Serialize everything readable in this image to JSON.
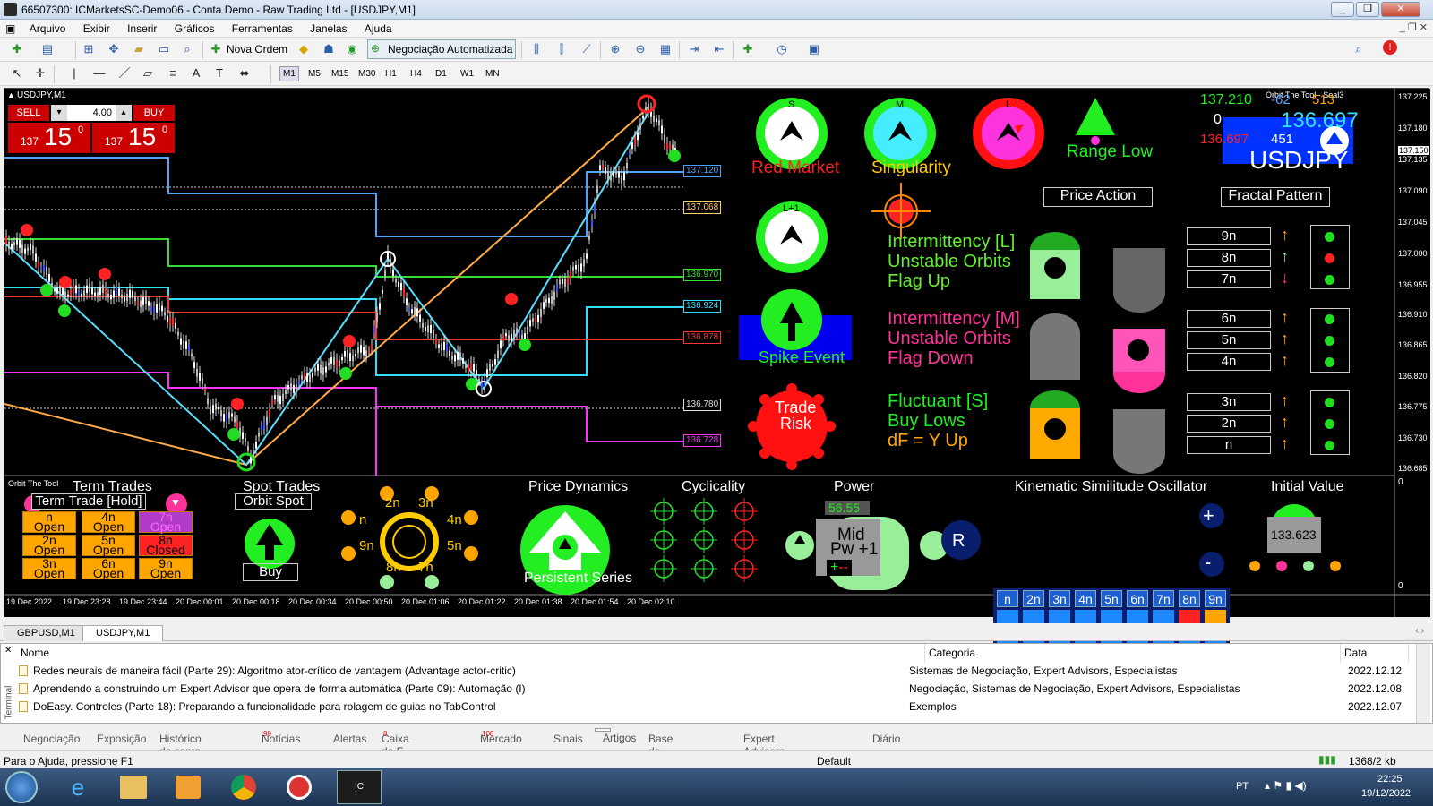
{
  "window": {
    "title": "66507300: ICMarketsSC-Demo06 - Conta Demo - Raw Trading Ltd - [USDJPY,M1]"
  },
  "menu": [
    "Arquivo",
    "Exibir",
    "Inserir",
    "Gráficos",
    "Ferramentas",
    "Janelas",
    "Ajuda"
  ],
  "toolbar": {
    "new_order": "Nova Ordem",
    "auto_trading": "Negociação Automatizada"
  },
  "timeframes": [
    "M1",
    "M5",
    "M15",
    "M30",
    "H1",
    "H4",
    "D1",
    "W1",
    "MN"
  ],
  "chart": {
    "symbol_label": "USDJPY,M1",
    "trade_panel": {
      "sell": "SELL",
      "buy": "BUY",
      "lot": "4.00",
      "sell_prefix": "137",
      "sell_price": "15",
      "sell_sup": "0",
      "buy_prefix": "137",
      "buy_price": "15",
      "buy_sup": "0"
    },
    "price_axis": [
      "137.225",
      "137.180",
      "137.150",
      "137.135",
      "137.090",
      "137.045",
      "137.000",
      "136.955",
      "136.910",
      "136.865",
      "136.820",
      "136.775",
      "136.730",
      "136.685"
    ],
    "level_labels": [
      {
        "text": "137.120",
        "color": "#4da3ff"
      },
      {
        "text": "137.068",
        "color": "#ffcc66"
      },
      {
        "text": "136.970",
        "color": "#33dd33"
      },
      {
        "text": "136.924",
        "color": "#33ddff"
      },
      {
        "text": "136.878",
        "color": "#ff3333"
      },
      {
        "text": "136.780",
        "color": "#dddddd"
      },
      {
        "text": "136.728",
        "color": "#ff33ff"
      }
    ],
    "time_axis": [
      "19 Dec 2022",
      "19 Dec 23:28",
      "19 Dec 23:44",
      "20 Dec 00:01",
      "20 Dec 00:18",
      "20 Dec 00:34",
      "20 Dec 00:50",
      "20 Dec 01:06",
      "20 Dec 01:22",
      "20 Dec 01:38",
      "20 Dec 01:54",
      "20 Dec 02:10"
    ],
    "corner_title": "Orbit The Tool - Seal3",
    "info": {
      "price_green": "137.210",
      "zero": "0",
      "num_blue1": "-62",
      "num_orange": "513",
      "price_red": "136.697",
      "big_price": "136.697",
      "count": "451",
      "symbol": "USDJPY"
    },
    "gauges": {
      "red_market": "Red Market",
      "singularity": "Singularity",
      "range_low": "Range Low",
      "spike_event": "Spike Event",
      "trade": "Trade",
      "risk": "Risk",
      "s": "S",
      "m": "M",
      "l": "L",
      "l1": "L+1"
    },
    "headers": {
      "price_action": "Price Action",
      "fractal_pattern": "Fractal Pattern"
    },
    "intermittency_l": [
      "Intermittency [L]",
      "Unstable Orbits",
      "Flag Up"
    ],
    "intermittency_m": [
      "Intermittency [M]",
      "Unstable Orbits",
      "Flag Down"
    ],
    "fluctuant_s": [
      "Fluctuant [S]",
      "Buy Lows",
      "dF = Y Up"
    ],
    "fractal_rows": [
      "9n",
      "8n",
      "7n",
      "6n",
      "5n",
      "4n",
      "3n",
      "2n",
      "n"
    ],
    "panel_colors": {
      "green": "#33cc33",
      "pink": "#ff3399",
      "orange": "#ffa500"
    }
  },
  "subwindow": {
    "label": "Orbit The Tool",
    "term_trades": "Term Trades",
    "term_trade_hold": "Term Trade [Hold]",
    "tt_cells": [
      {
        "n": "n",
        "s": "Open"
      },
      {
        "n": "4n",
        "s": "Open"
      },
      {
        "n": "7n",
        "s": "Open"
      },
      {
        "n": "2n",
        "s": "Open"
      },
      {
        "n": "5n",
        "s": "Open"
      },
      {
        "n": "8n",
        "s": "Closed"
      },
      {
        "n": "3n",
        "s": "Open"
      },
      {
        "n": "6n",
        "s": "Open"
      },
      {
        "n": "9n",
        "s": "Open"
      }
    ],
    "spot_trades": "Spot Trades",
    "orbit_spot": "Orbit Spot",
    "buy": "Buy",
    "orbit_labels": [
      "2n",
      "3n",
      "n",
      "4n",
      "9n",
      "5n",
      "8n",
      "7n"
    ],
    "price_dynamics": "Price Dynamics",
    "persistent_series": "Persistent Series",
    "cyclicality": "Cyclicality",
    "power": "Power",
    "power_value": "56.55",
    "mid": "Mid",
    "pw": "Pw +1",
    "kso_title": "Kinematic Similitude Oscillator",
    "kso_cols": [
      "n",
      "2n",
      "3n",
      "4n",
      "5n",
      "6n",
      "7n",
      "8n",
      "9n"
    ],
    "r": "R",
    "plus": "+",
    "minus": "-",
    "initial_value": "Initial Value",
    "initial_number": "133.623",
    "sub_axis": [
      "0",
      "0"
    ]
  },
  "chart_tabs": [
    "GBPUSD,M1",
    "USDJPY,M1"
  ],
  "terminal": {
    "headers": [
      "Nome",
      "Categoria",
      "Data"
    ],
    "rows": [
      {
        "name": "Redes neurais de maneira fácil (Parte 29): Algoritmo ator-crítico de vantagem (Advantage actor-critic)",
        "cat": "Sistemas de Negociação, Expert Advisors, Especialistas",
        "date": "2022.12.12"
      },
      {
        "name": "Aprendendo a construindo um Expert Advisor que opera de forma automática (Parte 09): Automação (I)",
        "cat": "Negociação, Sistemas de Negociação, Expert Advisors, Especialistas",
        "date": "2022.12.08"
      },
      {
        "name": "DoEasy. Controles (Parte 18): Preparando a funcionalidade para rolagem de guias no TabControl",
        "cat": "Exemplos",
        "date": "2022.12.07"
      }
    ],
    "side_label": "Terminal",
    "tabs": [
      "Negociação",
      "Exposição",
      "Histórico da conta",
      "Notícias",
      "Alertas",
      "Caixa de E-mail",
      "Mercado",
      "Sinais",
      "Artigos",
      "Base de Código",
      "Expert Advisors (Robôs)",
      "Diário"
    ],
    "badges": {
      "noticias": "99",
      "email": "8",
      "mercado": "108"
    }
  },
  "status": {
    "help": "Para o Ajuda, pressione F1",
    "profile": "Default",
    "traffic": "1368/2 kb"
  },
  "taskbar": {
    "lang": "PT",
    "time": "22:25",
    "date": "19/12/2022"
  }
}
